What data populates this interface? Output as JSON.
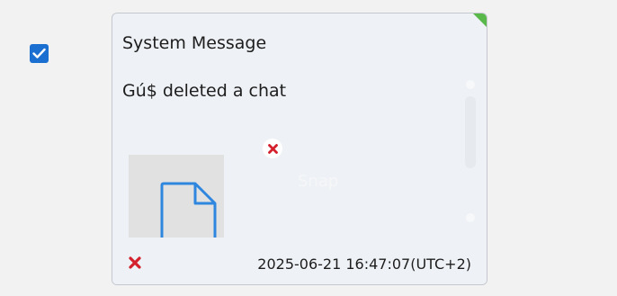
{
  "message": {
    "selected": true,
    "header": "System Message",
    "body": "Gú$ deleted a chat",
    "attachment": {
      "icon": "file-icon",
      "caption": "Snap"
    },
    "timestamp": "2025-06-21 16:47:07(UTC+2)",
    "status_icon": "red-x-icon"
  },
  "colors": {
    "checkbox": "#1a6fd1",
    "card_background": "#eef1f5",
    "corner_marker": "#59b84a",
    "error_red": "#d3202c",
    "file_icon_blue": "#2f86de"
  }
}
